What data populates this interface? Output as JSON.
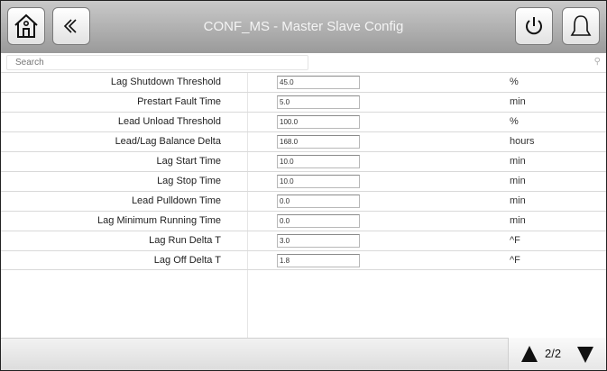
{
  "header": {
    "title": "CONF_MS - Master Slave Config",
    "home_icon": "home-icon",
    "back_icon": "double-chevron-left-icon",
    "power_icon": "power-icon",
    "bell_icon": "bell-icon"
  },
  "search": {
    "placeholder": "Search"
  },
  "rows": [
    {
      "label": "Lag Shutdown Threshold",
      "value": "45.0",
      "unit": "%"
    },
    {
      "label": "Prestart Fault Time",
      "value": "5.0",
      "unit": "min"
    },
    {
      "label": "Lead Unload Threshold",
      "value": "100.0",
      "unit": "%"
    },
    {
      "label": "Lead/Lag Balance Delta",
      "value": "168.0",
      "unit": "hours"
    },
    {
      "label": "Lag Start Time",
      "value": "10.0",
      "unit": "min"
    },
    {
      "label": "Lag Stop Time",
      "value": "10.0",
      "unit": "min"
    },
    {
      "label": "Lead Pulldown Time",
      "value": "0.0",
      "unit": "min"
    },
    {
      "label": "Lag Minimum Running Time",
      "value": "0.0",
      "unit": "min"
    },
    {
      "label": "Lag Run Delta T",
      "value": "3.0",
      "unit": "^F"
    },
    {
      "label": "Lag Off Delta T",
      "value": "1.8",
      "unit": "^F"
    }
  ],
  "pager": {
    "page": "2/2"
  }
}
